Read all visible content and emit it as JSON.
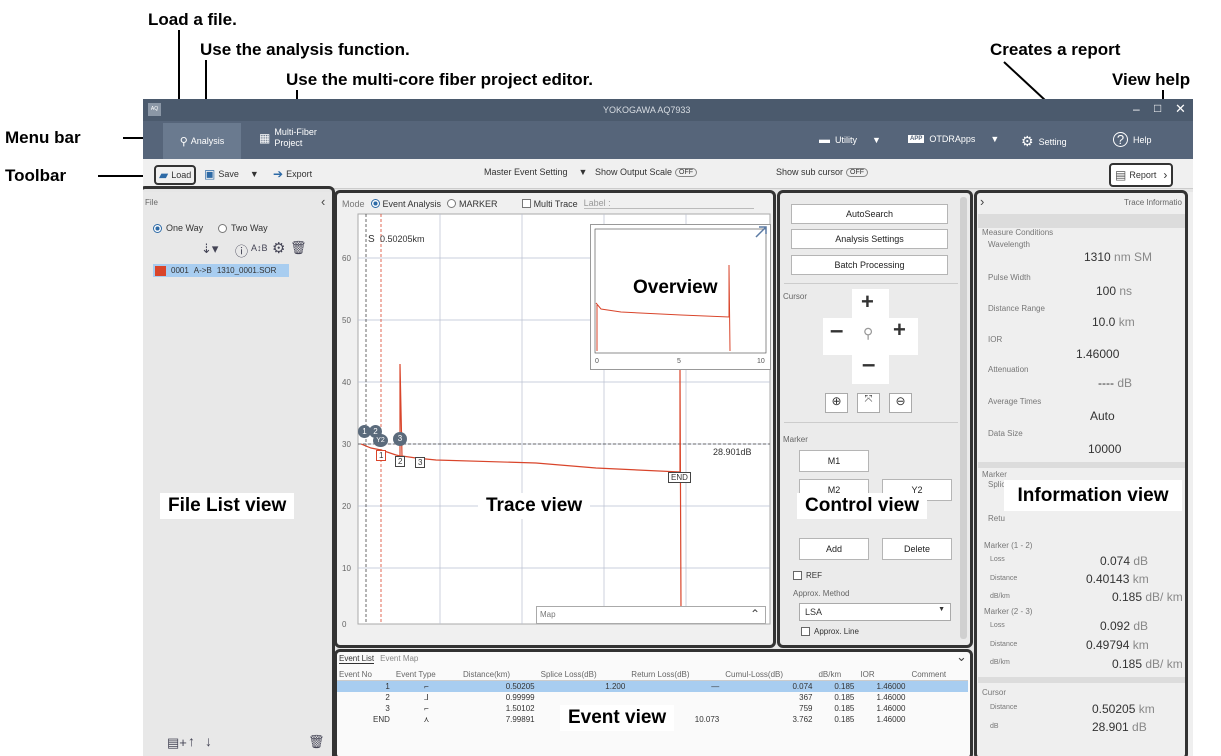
{
  "annotations": {
    "load": "Load a file.",
    "analysis": "Use the analysis function.",
    "mcf": "Use the multi-core fiber project editor.",
    "report": "Creates a report",
    "help": "View help",
    "menubar": "Menu bar",
    "toolbar": "Toolbar",
    "overview": "Overview",
    "file_list": "File List view",
    "trace": "Trace view",
    "control": "Control view",
    "information": "Information view",
    "event": "Event view"
  },
  "app": {
    "title": "YOKOGAWA AQ7933",
    "icon_label": "AQ"
  },
  "menu": {
    "analysis": "Analysis",
    "multifiber_1": "Multi-Fiber",
    "multifiber_2": "Project",
    "utility": "Utility",
    "otdrapps": "OTDRApps",
    "setting": "Setting",
    "help": "Help"
  },
  "toolbar": {
    "load": "Load",
    "save": "Save",
    "export": "Export",
    "master_event": "Master Event Setting",
    "show_output_scale": "Show Output Scale",
    "show_sub_cursor": "Show sub cursor",
    "off": "OFF",
    "report": "Report"
  },
  "filelist": {
    "header": "File",
    "one_way": "One Way",
    "two_way": "Two Way",
    "row": {
      "num": "0001",
      "dir": "A->B",
      "name": "1310_0001.SOR",
      "color": "#d9452b"
    }
  },
  "trace": {
    "mode": "Mode",
    "event_analysis": "Event Analysis",
    "marker": "MARKER",
    "multi_trace": "Multi Trace",
    "label": "Label :",
    "s_label": "S",
    "cursor_dist": "0.50205km",
    "cursor_db": "28.901dB",
    "end": "END",
    "map": "Map",
    "y_ticks": [
      "60",
      "50",
      "40",
      "30",
      "20",
      "10",
      "0"
    ],
    "overview_x": [
      "0",
      "5",
      "10"
    ],
    "markers": {
      "m1": "1",
      "m2": "2",
      "m3": "3",
      "y2": "Y2"
    },
    "event_boxes": [
      "1",
      "2",
      "3"
    ]
  },
  "control": {
    "autosearch": "AutoSearch",
    "analysis_settings": "Analysis Settings",
    "batch": "Batch Processing",
    "cursor": "Cursor",
    "marker": "Marker",
    "m1": "M1",
    "m2": "M2",
    "y2": "Y2",
    "add": "Add",
    "delete": "Delete",
    "ref": "REF",
    "approx_method": "Approx. Method",
    "lsa": "LSA",
    "approx_line": "Approx. Line"
  },
  "info": {
    "header": "Trace Informatio",
    "measure": "Measure Conditions",
    "wavelength": "Wavelength",
    "wavelength_v": "1310",
    "wavelength_u": "nm SM",
    "pulse": "Pulse Width",
    "pulse_v": "100",
    "pulse_u": "ns",
    "range": "Distance Range",
    "range_v": "10.0",
    "range_u": "km",
    "ior": "IOR",
    "ior_v": "1.46000",
    "atten": "Attenuation",
    "atten_v": "----",
    "atten_u": "dB",
    "avg": "Average Times",
    "avg_v": "Auto",
    "size": "Data Size",
    "size_v": "10000",
    "marker": "Marker",
    "splice": "Splic",
    "ret": "Retu",
    "m12": "Marker (1 - 2)",
    "m12_loss": "0.074",
    "m12_dist": "0.40143",
    "m12_dbkm": "0.185",
    "m23": "Marker (2 - 3)",
    "m23_loss": "0.092",
    "m23_dist": "0.49794",
    "m23_dbkm": "0.185",
    "loss": "Loss",
    "distance": "Distance",
    "dbkm": "dB/km",
    "cursor": "Cursor",
    "cur_dist": "0.50205",
    "cur_db": "28.901",
    "db": "dB",
    "km": "km",
    "dbkm_u": "dB/ km"
  },
  "events": {
    "tab1": "Event List",
    "tab2": "Event Map",
    "columns": [
      "Event No",
      "Event Type",
      "Distance(km)",
      "Splice Loss(dB)",
      "Return Loss(dB)",
      "Cumul-Loss(dB)",
      "dB/km",
      "IOR",
      "Comment"
    ],
    "rows": [
      [
        "1",
        "",
        "0.50205",
        "1.200",
        "—",
        "0.074",
        "0.185",
        "1.46000",
        ""
      ],
      [
        "2",
        "",
        "0.99999",
        "",
        "",
        "367",
        "0.185",
        "1.46000",
        ""
      ],
      [
        "3",
        "",
        "1.50102",
        "",
        "",
        "759",
        "0.185",
        "1.46000",
        ""
      ],
      [
        "END",
        "",
        "7.99891",
        "",
        "10.073",
        "3.762",
        "0.185",
        "1.46000",
        ""
      ]
    ]
  }
}
